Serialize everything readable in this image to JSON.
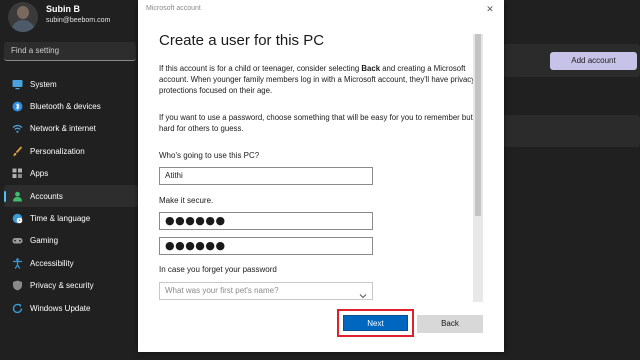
{
  "settings": {
    "profile": {
      "name": "Subin B",
      "email": "subin@beebom.com"
    },
    "search": {
      "placeholder": "Find a setting"
    },
    "nav": [
      {
        "label": "System",
        "icon": "monitor-icon",
        "color": "#4aa3df"
      },
      {
        "label": "Bluetooth & devices",
        "icon": "bluetooth-icon",
        "color": "#2f8ee0"
      },
      {
        "label": "Network & internet",
        "icon": "wifi-icon",
        "color": "#4aa3df"
      },
      {
        "label": "Personalization",
        "icon": "brush-icon",
        "color": "#e0a040"
      },
      {
        "label": "Apps",
        "icon": "apps-icon",
        "color": "#b0b0b0"
      },
      {
        "label": "Accounts",
        "icon": "person-icon",
        "color": "#3fb96b",
        "active": true
      },
      {
        "label": "Time & language",
        "icon": "globe-clock-icon",
        "color": "#3a9ad9"
      },
      {
        "label": "Gaming",
        "icon": "gamepad-icon",
        "color": "#9a9a9a"
      },
      {
        "label": "Accessibility",
        "icon": "accessibility-icon",
        "color": "#3a9ad9"
      },
      {
        "label": "Privacy & security",
        "icon": "shield-icon",
        "color": "#8a8a8a"
      },
      {
        "label": "Windows Update",
        "icon": "update-icon",
        "color": "#3a9ad9"
      }
    ],
    "add_account_label": "Add account",
    "accent": "#4cc2ff"
  },
  "dialog": {
    "window_title": "Microsoft account",
    "heading": "Create a user for this PC",
    "para1_pre": "If this account is for a child or teenager, consider selecting ",
    "para1_bold": "Back",
    "para1_post": " and creating a Microsoft account. When younger family members log in with a Microsoft account, they'll have privacy protections focused on their age.",
    "para2": "If you want to use a password, choose something that will be easy for you to remember but hard for others to guess.",
    "who_label": "Who's going to use this PC?",
    "username_value": "Atithi",
    "secure_label": "Make it secure.",
    "password_value": "●●●●●●",
    "confirm_password_value": "●●●●●●",
    "forget_label": "In case you forget your password",
    "security_question_placeholder": "What was your first pet's name?",
    "next_label": "Next",
    "back_label": "Back",
    "next_color": "#0067c0",
    "highlight_color": "#e0202a"
  }
}
